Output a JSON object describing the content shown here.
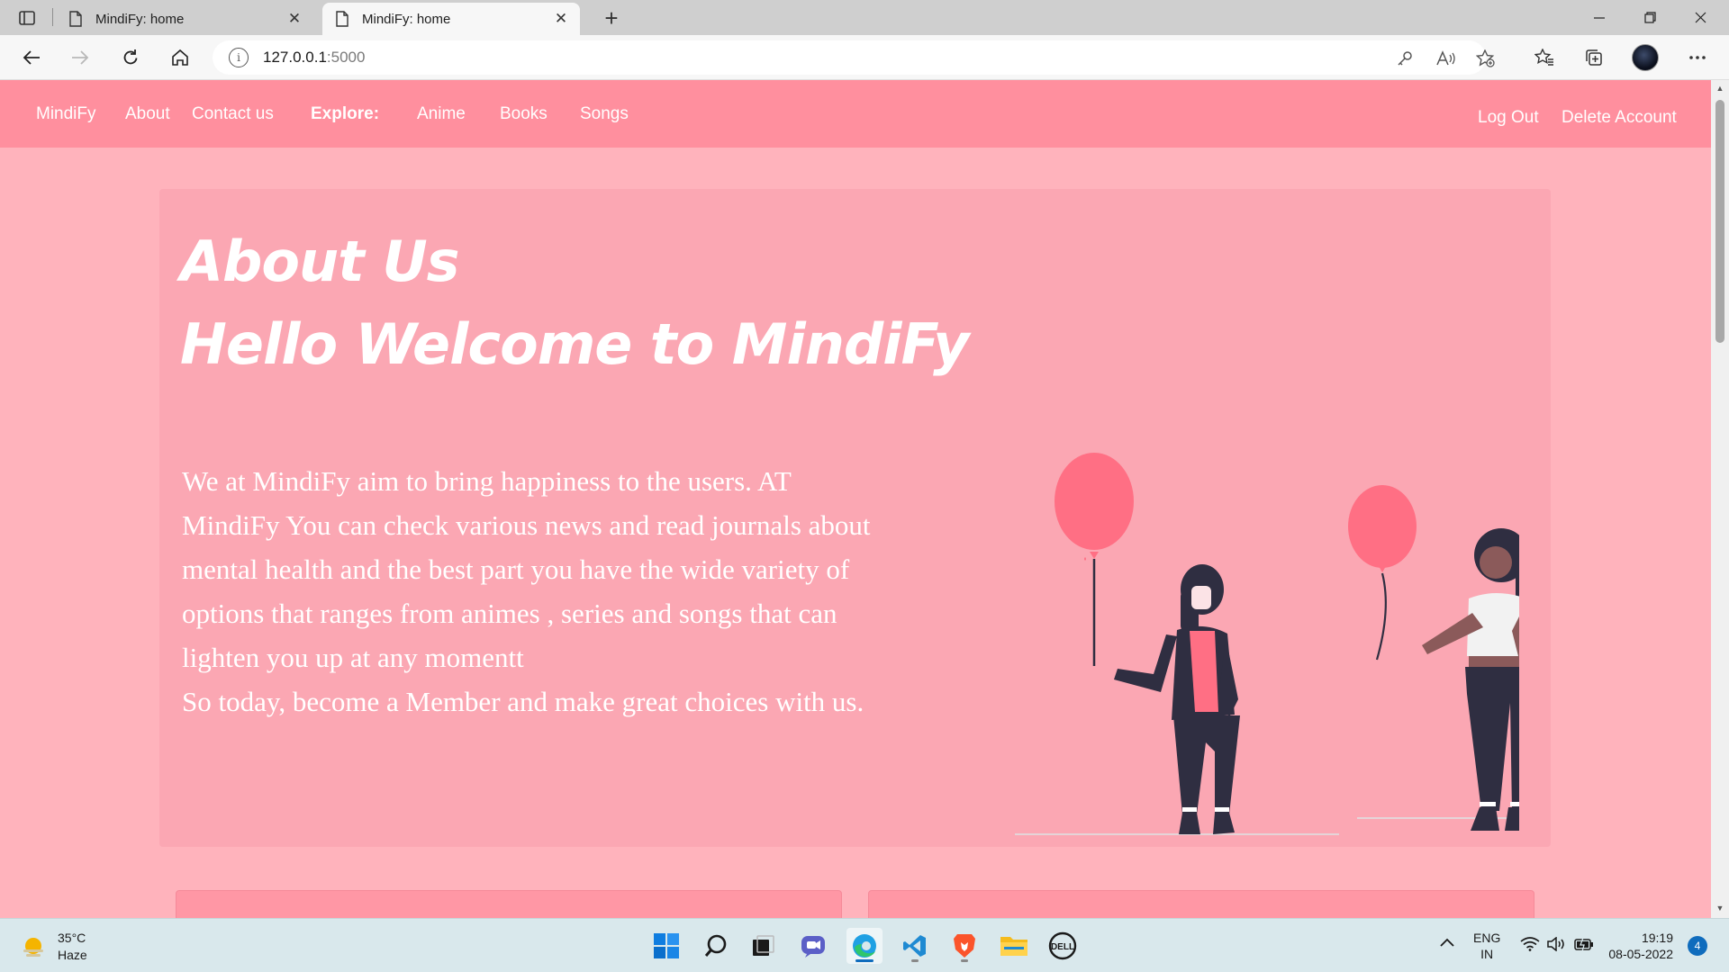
{
  "browser": {
    "tabs": [
      {
        "title": "MindiFy: home",
        "active": false
      },
      {
        "title": "MindiFy: home",
        "active": true
      }
    ],
    "new_tab_symbol": "+",
    "close_symbol": "✕",
    "address": {
      "host": "127.0.0.1",
      "port": ":5000"
    }
  },
  "navbar": {
    "brand": "MindiFy",
    "about": "About",
    "contact": "Contact us",
    "explore": "Explore:",
    "anime": "Anime",
    "books": "Books",
    "songs": "Songs",
    "logout": "Log Out",
    "delete_account": "Delete Account"
  },
  "hero": {
    "heading1": "About Us",
    "heading2": "Hello Welcome to MindiFy",
    "paragraph1": "We at MindiFy aim to bring happiness to the users. AT MindiFy You can check various news and read journals about mental health and the best part you have the wide variety of options that ranges from animes , series and songs that can lighten you up at any momentt",
    "paragraph2": "So today, become a Member and make great choices with us."
  },
  "taskbar": {
    "weather": {
      "temp": "35°C",
      "condition": "Haze"
    },
    "language": {
      "line1": "ENG",
      "line2": "IN"
    },
    "clock": {
      "time": "19:19",
      "date": "08-05-2022"
    },
    "notifications": "4"
  },
  "colors": {
    "navbar": "#ff8f9e",
    "page_background": "#ffb3bc",
    "hero_card": "#fba7b3",
    "balloon": "#ff6f84",
    "figure_dark": "#2f2e41"
  }
}
